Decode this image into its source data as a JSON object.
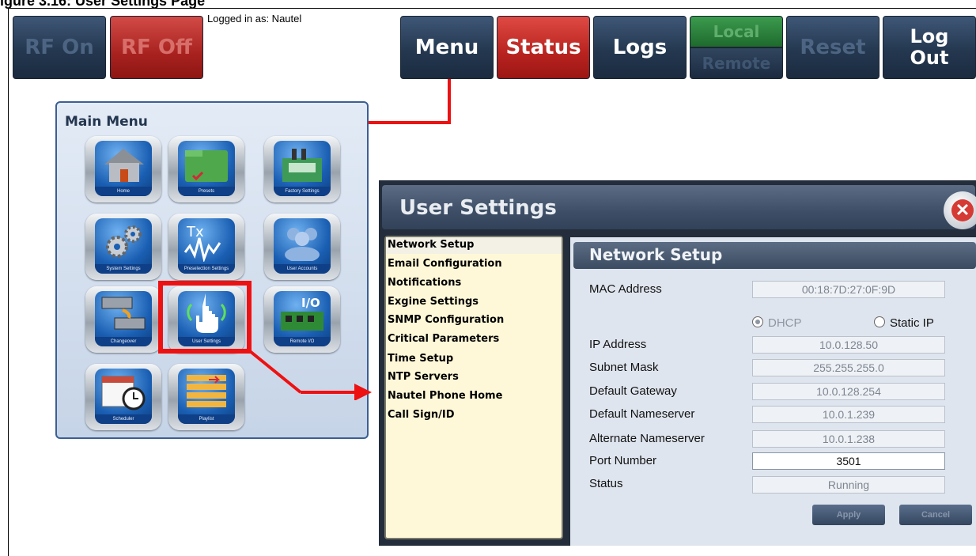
{
  "figure": {
    "title": "igure 3.16: User Settings Page"
  },
  "toolbar": {
    "rf_on": "RF On",
    "rf_off": "RF Off",
    "logged_in": "Logged in as: Nautel",
    "menu": "Menu",
    "status": "Status",
    "logs": "Logs",
    "local": "Local",
    "remote": "Remote",
    "reset": "Reset",
    "logout": "Log Out"
  },
  "main_menu": {
    "title": "Main Menu",
    "tiles": [
      {
        "label": "Home",
        "icon": "house-icon"
      },
      {
        "label": "Presets",
        "icon": "folder-icon"
      },
      {
        "label": "Factory Settings",
        "icon": "factory-icon"
      },
      {
        "label": "System Settings",
        "icon": "gears-icon"
      },
      {
        "label": "Preselection Settings",
        "icon": "waveform-icon"
      },
      {
        "label": "User Accounts",
        "icon": "users-icon"
      },
      {
        "label": "Changeover",
        "icon": "changeover-icon"
      },
      {
        "label": "User Settings",
        "icon": "touch-hand-icon"
      },
      {
        "label": "Remote I/O",
        "icon": "io-board-icon"
      },
      {
        "label": "Scheduler",
        "icon": "calendar-clock-icon"
      },
      {
        "label": "Playlist",
        "icon": "playlist-icon"
      }
    ],
    "io_text": "I/O",
    "tx_text": "Tx"
  },
  "user_settings": {
    "title": "User Settings",
    "menu": [
      "Network Setup",
      "Email Configuration",
      "Notifications",
      "Exgine Settings",
      "SNMP Configuration",
      "Critical Parameters",
      "Time Setup",
      "NTP Servers",
      "Nautel Phone Home",
      "Call Sign/ID"
    ],
    "network_setup": {
      "title": "Network Setup",
      "mac_label": "MAC Address",
      "mac_value": "00:18:7D:27:0F:9D",
      "dhcp_label": "DHCP",
      "static_label": "Static IP",
      "fields": [
        {
          "label": "IP Address",
          "value": "10.0.128.50"
        },
        {
          "label": "Subnet Mask",
          "value": "255.255.255.0"
        },
        {
          "label": "Default Gateway",
          "value": "10.0.128.254"
        },
        {
          "label": "Default Nameserver",
          "value": "10.0.1.239"
        },
        {
          "label": "Alternate Nameserver",
          "value": "10.0.1.238"
        },
        {
          "label": "Port Number",
          "value": "3501"
        },
        {
          "label": "Status",
          "value": "Running"
        }
      ],
      "apply": "Apply",
      "cancel": "Cancel"
    }
  }
}
